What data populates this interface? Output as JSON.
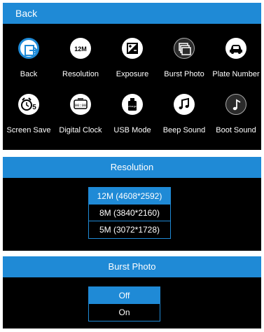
{
  "menu": {
    "header": "Back",
    "items": [
      {
        "label": "Back",
        "icon": "back-exit-icon"
      },
      {
        "label": "Resolution",
        "icon": "resolution-12m-icon",
        "badge": "12M"
      },
      {
        "label": "Exposure",
        "icon": "exposure-icon"
      },
      {
        "label": "Burst Photo",
        "icon": "burst-photo-icon"
      },
      {
        "label": "Plate Number",
        "icon": "car-icon"
      },
      {
        "label": "Screen Save",
        "icon": "alarm-clock-icon",
        "badge": "5"
      },
      {
        "label": "Digital Clock",
        "icon": "digital-clock-icon",
        "badge": "00:00"
      },
      {
        "label": "USB Mode",
        "icon": "usb-charge-icon",
        "badge": "charge"
      },
      {
        "label": "Beep Sound",
        "icon": "music-note-icon"
      },
      {
        "label": "Boot Sound",
        "icon": "music-note-icon"
      }
    ]
  },
  "resolution": {
    "title": "Resolution",
    "options": [
      "12M (4608*2592)",
      "8M (3840*2160)",
      "5M (3072*1728)"
    ],
    "selected": "12M (4608*2592)"
  },
  "burst": {
    "title": "Burst Photo",
    "options": [
      "Off",
      "On"
    ],
    "selected": "Off"
  },
  "colors": {
    "accent": "#1f8ad6",
    "background": "#000000",
    "text": "#ffffff"
  }
}
